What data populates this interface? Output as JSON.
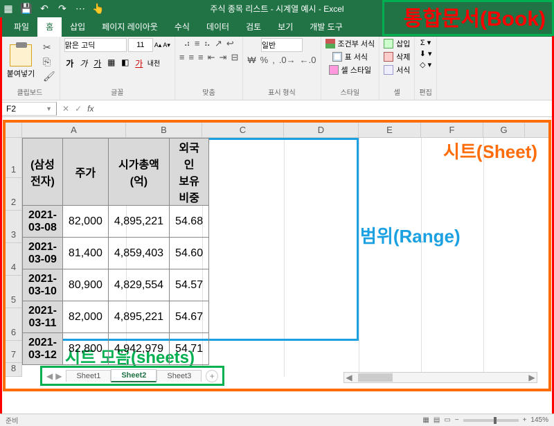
{
  "title": "주식 종목 리스트 - 시계열 예시 - Excel",
  "tabs": [
    "파일",
    "홈",
    "삽입",
    "페이지 레이아웃",
    "수식",
    "데이터",
    "검토",
    "보기",
    "개발 도구"
  ],
  "activeTab": 1,
  "ribbon": {
    "clipboard": {
      "paste": "붙여넣기",
      "label": "클립보드"
    },
    "font": {
      "name": "맑은 고딕",
      "size": "11",
      "label": "글꼴"
    },
    "align": {
      "label": "맞춤"
    },
    "number": {
      "format": "일반",
      "label": "표시 형식"
    },
    "style": {
      "cond": "조건부 서식",
      "table": "표 서식",
      "cell": "셀 스타일",
      "label": "스타일"
    },
    "cells": {
      "insert": "삽입",
      "delete": "삭제",
      "format": "서식",
      "label": "셀"
    },
    "edit": {
      "label": "편집"
    }
  },
  "nameBox": "F2",
  "columns": [
    "A",
    "B",
    "C",
    "D",
    "E",
    "F",
    "G"
  ],
  "rowNums": [
    1,
    2,
    3,
    4,
    5,
    6,
    7,
    8
  ],
  "headers": [
    "(삼성전자)",
    "주가",
    "시가총액\n(억)",
    "외국인\n보유비중"
  ],
  "rows": [
    {
      "date": "2021-03-08",
      "price": "82,000",
      "cap": "4,895,221",
      "foreign": "54.68"
    },
    {
      "date": "2021-03-09",
      "price": "81,400",
      "cap": "4,859,403",
      "foreign": "54.60"
    },
    {
      "date": "2021-03-10",
      "price": "80,900",
      "cap": "4,829,554",
      "foreign": "54.57"
    },
    {
      "date": "2021-03-11",
      "price": "82,000",
      "cap": "4,895,221",
      "foreign": "54.67"
    },
    {
      "date": "2021-03-12",
      "price": "82,800",
      "cap": "4,942,979",
      "foreign": "54.71"
    }
  ],
  "sheetTabs": [
    "Sheet1",
    "Sheet2",
    "Sheet3"
  ],
  "activeSheet": 1,
  "annotations": {
    "book": "통합문서(Book)",
    "sheet": "시트(Sheet)",
    "range": "범위(Range)",
    "sheets": "시트 모음(sheets)"
  },
  "status": {
    "ready": "준비",
    "zoom": "145%"
  }
}
